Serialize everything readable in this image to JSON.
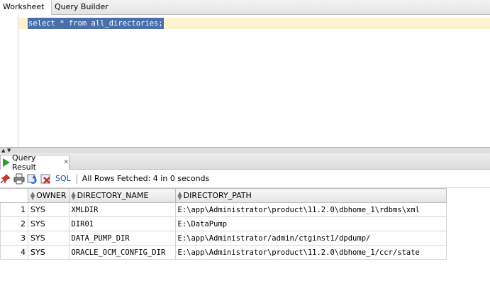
{
  "tabs": {
    "worksheet": "Worksheet",
    "query_builder": "Query Builder"
  },
  "editor": {
    "sql": "select * from all_directories;"
  },
  "result": {
    "tab_label": "Query Result",
    "sql_button": "SQL",
    "status": "All Rows Fetched: 4 in 0 seconds",
    "columns": [
      "OWNER",
      "DIRECTORY_NAME",
      "DIRECTORY_PATH"
    ],
    "rows": [
      {
        "num": "1",
        "owner": "SYS",
        "name": "XMLDIR",
        "path": "E:\\app\\Administrator\\product\\11.2.0\\dbhome_1\\rdbms\\xml"
      },
      {
        "num": "2",
        "owner": "SYS",
        "name": "DIR01",
        "path": "E:\\DataPump"
      },
      {
        "num": "3",
        "owner": "SYS",
        "name": "DATA_PUMP_DIR",
        "path": "E:\\app\\Administrator/admin/ctginst1/dpdump/"
      },
      {
        "num": "4",
        "owner": "SYS",
        "name": "ORACLE_OCM_CONFIG_DIR",
        "path": "E:\\app\\Administrator\\product\\11.2.0\\dbhome_1/ccr/state"
      }
    ]
  }
}
